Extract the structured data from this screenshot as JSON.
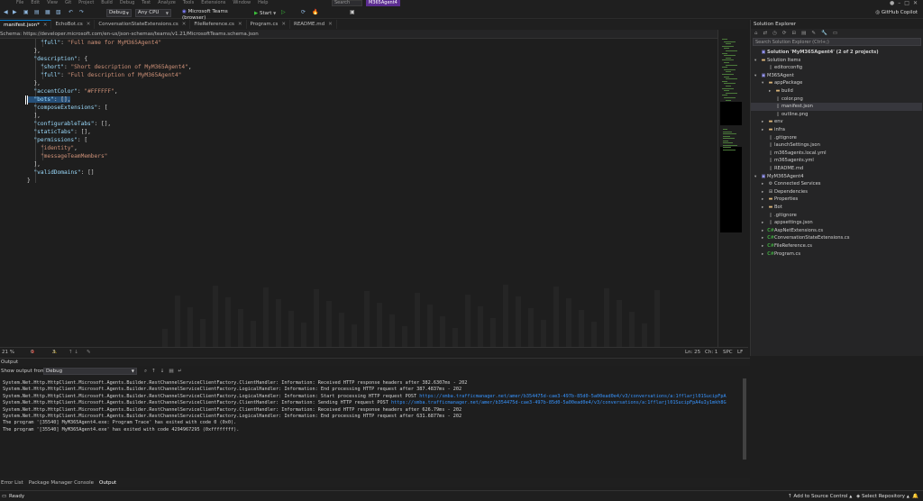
{
  "menubar": {
    "menus": [
      "File",
      "Edit",
      "View",
      "Git",
      "Project",
      "Build",
      "Debug",
      "Test",
      "Analyze",
      "Tools",
      "Extensions",
      "Window",
      "Help"
    ],
    "search": "Search",
    "project": "M365Agent4"
  },
  "toolbar": {
    "config": "Debug",
    "platform": "Any CPU",
    "target": "Microsoft Teams (browser)",
    "start": "Start",
    "copilot": "GitHub Copilot"
  },
  "tabs": [
    {
      "label": "manifest.json*",
      "active": true
    },
    {
      "label": "EchoBot.cs",
      "active": false
    },
    {
      "label": "ConversationStateExtensions.cs",
      "active": false
    },
    {
      "label": "FileReference.cs",
      "active": false
    },
    {
      "label": "Program.cs",
      "active": false
    },
    {
      "label": "README.md",
      "active": false
    }
  ],
  "schema": {
    "label": "Schema:",
    "url": "https://developer.microsoft.com/en-us/json-schemas/teams/v1.21/MicrosoftTeams.schema.json"
  },
  "code": {
    "lines": [
      "    \"full\": \"Full name for MyM365Agent4\"",
      "  },",
      "  \"description\": {",
      "    \"short\": \"Short description of MyM365Agent4\",",
      "    \"full\": \"Full description of MyM365Agent4\"",
      "  },",
      "  \"accentColor\": \"#FFFFFF\",",
      "  \"bots\": [],",
      "  \"composeExtensions\": [",
      "  ],",
      "  \"configurableTabs\": [],",
      "  \"staticTabs\": [],",
      "  \"permissions\": [",
      "    \"identity\",",
      "    \"messageTeamMembers\"",
      "  ],",
      "  \"validDomains\": []",
      "}"
    ]
  },
  "editor_status": {
    "zoom": "21 %",
    "errors": "0",
    "warnings": "3",
    "line": "Ln: 25",
    "col": "Ch: 1",
    "spc": "SPC",
    "eol": "LF"
  },
  "solution": {
    "title": "Solution Explorer",
    "search": "Search Solution Explorer (Ctrl+;)",
    "items": [
      {
        "label": "Solution 'MyM365Agent4' (2 of 2 projects)",
        "depth": 0,
        "icon": "solution",
        "arrow": "",
        "bold": true
      },
      {
        "label": "Solution Items",
        "depth": 0,
        "icon": "folder",
        "arrow": "▾"
      },
      {
        "label": "editorconfig",
        "depth": 1,
        "icon": "file",
        "arrow": ""
      },
      {
        "label": "M365Agent",
        "depth": 0,
        "icon": "project",
        "arrow": "▾"
      },
      {
        "label": "appPackage",
        "depth": 1,
        "icon": "folder",
        "arrow": "▾"
      },
      {
        "label": "build",
        "depth": 2,
        "icon": "folder",
        "arrow": "▸"
      },
      {
        "label": "color.png",
        "depth": 2,
        "icon": "file",
        "arrow": ""
      },
      {
        "label": "manifest.json",
        "depth": 2,
        "icon": "file",
        "arrow": "",
        "selected": true
      },
      {
        "label": "outline.png",
        "depth": 2,
        "icon": "file",
        "arrow": ""
      },
      {
        "label": "env",
        "depth": 1,
        "icon": "folder",
        "arrow": "▸"
      },
      {
        "label": "infra",
        "depth": 1,
        "icon": "folder",
        "arrow": "▸"
      },
      {
        "label": ".gitignore",
        "depth": 1,
        "icon": "file",
        "arrow": ""
      },
      {
        "label": "launchSettings.json",
        "depth": 1,
        "icon": "file",
        "arrow": ""
      },
      {
        "label": "m365agents.local.yml",
        "depth": 1,
        "icon": "file",
        "arrow": ""
      },
      {
        "label": "m365agents.yml",
        "depth": 1,
        "icon": "file",
        "arrow": ""
      },
      {
        "label": "README.md",
        "depth": 1,
        "icon": "file",
        "arrow": ""
      },
      {
        "label": "MyM365Agent4",
        "depth": 0,
        "icon": "csproj",
        "arrow": "▾"
      },
      {
        "label": "Connected Services",
        "depth": 1,
        "icon": "services",
        "arrow": "▸"
      },
      {
        "label": "Dependencies",
        "depth": 1,
        "icon": "deps",
        "arrow": "▸"
      },
      {
        "label": "Properties",
        "depth": 1,
        "icon": "folder",
        "arrow": "▸"
      },
      {
        "label": "Bot",
        "depth": 1,
        "icon": "folder",
        "arrow": "▸"
      },
      {
        "label": ".gitignore",
        "depth": 1,
        "icon": "file",
        "arrow": ""
      },
      {
        "label": "appsettings.json",
        "depth": 1,
        "icon": "file",
        "arrow": "▸"
      },
      {
        "label": "AspNetExtensions.cs",
        "depth": 1,
        "icon": "cs",
        "arrow": "▸"
      },
      {
        "label": "ConversationStateExtensions.cs",
        "depth": 1,
        "icon": "cs",
        "arrow": "▸"
      },
      {
        "label": "FileReference.cs",
        "depth": 1,
        "icon": "cs",
        "arrow": "▸"
      },
      {
        "label": "Program.cs",
        "depth": 1,
        "icon": "cs",
        "arrow": "▸"
      }
    ]
  },
  "output": {
    "title": "Output",
    "show_from_label": "Show output from:",
    "source": "Debug",
    "lines": [
      "System.Net.Http.HttpClient.Microsoft.Agents.Builder.RestChannelServiceClientFactory.ClientHandler: Information: Received HTTP response headers after 382.6307ms - 202",
      "System.Net.Http.HttpClient.Microsoft.Agents.Builder.RestChannelServiceClientFactory.LogicalHandler: Information: End processing HTTP request after 387.4837ms - 202",
      "System.Net.Http.HttpClient.Microsoft.Agents.Builder.RestChannelServiceClientFactory.LogicalHandler: Information: Start processing HTTP request POST https://smba.trafficmanager.net/amer/b354475d-cae3-497b-85d0-5a00ead0e4/v3/conversations/a:1fflarjl01SucipFpA",
      "System.Net.Http.HttpClient.Microsoft.Agents.Builder.RestChannelServiceClientFactory.ClientHandler: Information: Sending HTTP request POST https://smba.trafficmanager.net/amer/b354475d-cae3-497b-85d0-5a00ead0e4/v3/conversations/a:1fflarjl01SucipFpA4uIy1mkh8G",
      "System.Net.Http.HttpClient.Microsoft.Agents.Builder.RestChannelServiceClientFactory.ClientHandler: Information: Received HTTP response headers after 626.79ms - 202",
      "System.Net.Http.HttpClient.Microsoft.Agents.Builder.RestChannelServiceClientFactory.LogicalHandler: Information: End processing HTTP request after 631.6877ms - 202",
      "The program '[35540] MyM365Agent4.exe: Program Trace' has exited with code 0 (0x0).",
      "The program '[35540] MyM365Agent4.exe' has exited with code 4294967295 (0xffffffff)."
    ]
  },
  "bottom_tabs": [
    "Error List",
    "Package Manager Console",
    "Output"
  ],
  "statusbar": {
    "ready": "Ready",
    "source_control": "Add to Source Control",
    "repository": "Select Repository"
  },
  "colors": {
    "accent": "#007acc",
    "key": "#9cdcfe",
    "string": "#ce9178",
    "selection": "#264f78"
  }
}
